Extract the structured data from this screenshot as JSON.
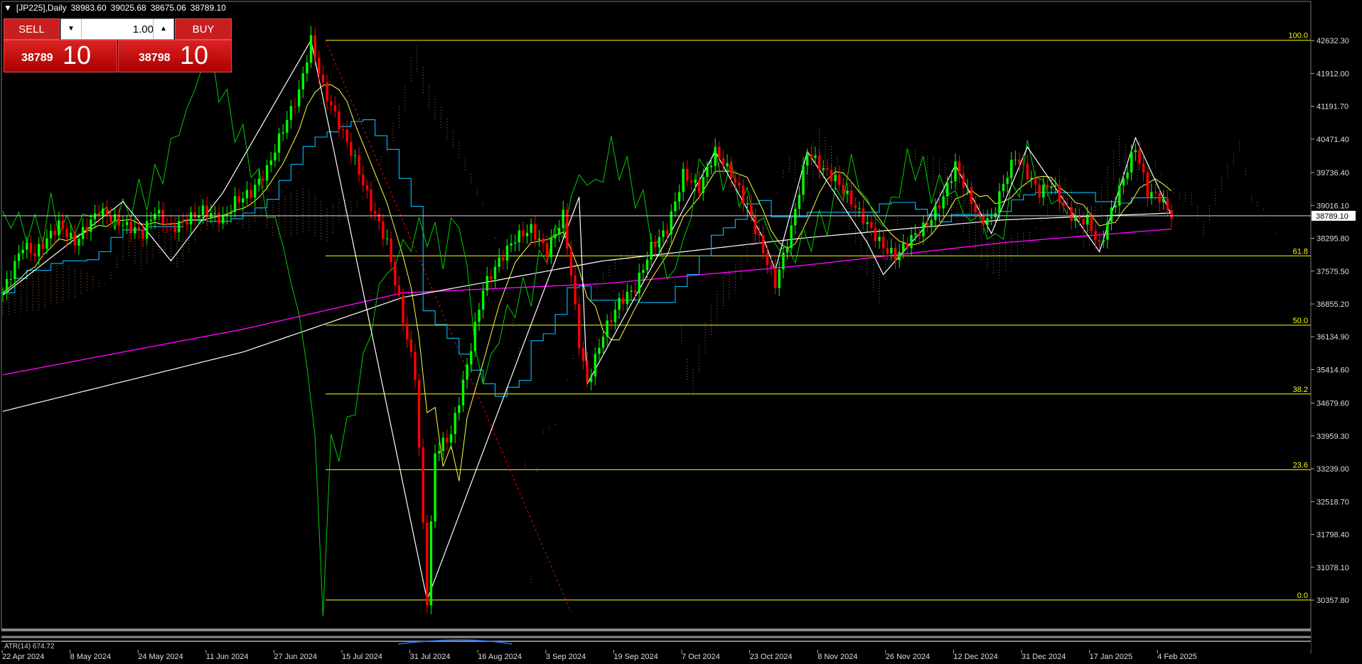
{
  "header": {
    "symbol": "[JP225],Daily",
    "open": "38983.60",
    "high": "39025.68",
    "low": "38675.06",
    "close": "38789.10"
  },
  "trade_panel": {
    "sell_label": "SELL",
    "buy_label": "BUY",
    "lot_value": "1.00",
    "sell_big": "38789",
    "sell_small": "10",
    "buy_big": "38798",
    "buy_small": "10"
  },
  "price_axis": {
    "labels": [
      "42632.30",
      "41912.00",
      "41191.70",
      "40471.40",
      "39736.40",
      "39016.10",
      "38295.80",
      "37575.50",
      "36855.20",
      "36134.90",
      "35414.60",
      "34679.60",
      "33959.30",
      "33239.00",
      "32518.70",
      "31798.40",
      "31078.10",
      "30357.80"
    ],
    "current_price": "38789.10"
  },
  "fib_levels": [
    {
      "label": "100.0",
      "price": 42640
    },
    {
      "label": "61.8",
      "price": 37910
    },
    {
      "label": "50.0",
      "price": 36390
    },
    {
      "label": "38.2",
      "price": 34880
    },
    {
      "label": "23.6",
      "price": 33220
    },
    {
      "label": "0.0",
      "price": 30360
    }
  ],
  "time_axis": {
    "labels": [
      "22 Apr 2024",
      "8 May 2024",
      "24 May 2024",
      "11 Jun 2024",
      "27 Jun 2024",
      "15 Jul 2024",
      "31 Jul 2024",
      "16 Aug 2024",
      "3 Sep 2024",
      "19 Sep 2024",
      "7 Oct 2024",
      "23 Oct 2024",
      "8 Nov 2024",
      "26 Nov 2024",
      "12 Dec 2024",
      "31 Dec 2024",
      "17 Jan 2025",
      "4 Feb 2025"
    ]
  },
  "atr_panel": {
    "label": "ATR(14) 674.72",
    "value": "674.72"
  },
  "colors": {
    "bull": "#00ff00",
    "bear": "#ff0000",
    "fib": "#ffff00",
    "ma_magenta": "#ff00ff",
    "ma_white": "#ffffff",
    "kijun": "#00bfff",
    "chikou": "#00cc00",
    "cloud": "#f4a460"
  },
  "chart_data": {
    "type": "candlestick",
    "price_min": 30000,
    "price_max": 42900,
    "series": [
      {
        "name": "price",
        "points": [
          [
            0,
            37100
          ],
          [
            5,
            38150
          ],
          [
            8,
            37950
          ],
          [
            14,
            38600
          ],
          [
            18,
            38200
          ],
          [
            24,
            38900
          ],
          [
            30,
            38600
          ],
          [
            35,
            38400
          ],
          [
            38,
            38900
          ],
          [
            42,
            38500
          ],
          [
            50,
            38900
          ],
          [
            55,
            38700
          ],
          [
            58,
            39100
          ],
          [
            62,
            39300
          ],
          [
            66,
            39800
          ],
          [
            70,
            40700
          ],
          [
            74,
            41500
          ],
          [
            77,
            42640
          ],
          [
            80,
            41600
          ],
          [
            84,
            40800
          ],
          [
            88,
            40000
          ],
          [
            92,
            39000
          ],
          [
            96,
            38200
          ],
          [
            100,
            36500
          ],
          [
            103,
            35300
          ],
          [
            106,
            30360
          ],
          [
            108,
            33600
          ],
          [
            112,
            34000
          ],
          [
            116,
            35500
          ],
          [
            120,
            37200
          ],
          [
            124,
            37800
          ],
          [
            128,
            38300
          ],
          [
            132,
            38500
          ],
          [
            136,
            38000
          ],
          [
            140,
            38800
          ],
          [
            142,
            37500
          ],
          [
            144,
            36000
          ],
          [
            146,
            35100
          ],
          [
            150,
            36200
          ],
          [
            154,
            36900
          ],
          [
            158,
            37200
          ],
          [
            162,
            38100
          ],
          [
            166,
            38500
          ],
          [
            170,
            39700
          ],
          [
            174,
            39400
          ],
          [
            178,
            40200
          ],
          [
            182,
            39700
          ],
          [
            186,
            39000
          ],
          [
            190,
            38000
          ],
          [
            193,
            37300
          ],
          [
            197,
            38500
          ],
          [
            201,
            40200
          ],
          [
            205,
            39800
          ],
          [
            208,
            39600
          ],
          [
            212,
            39100
          ],
          [
            216,
            38600
          ],
          [
            220,
            38100
          ],
          [
            223,
            37900
          ],
          [
            227,
            38300
          ],
          [
            231,
            38600
          ],
          [
            235,
            39200
          ],
          [
            238,
            39900
          ],
          [
            241,
            39300
          ],
          [
            244,
            38700
          ],
          [
            247,
            38700
          ],
          [
            250,
            39500
          ],
          [
            253,
            40100
          ],
          [
            256,
            39700
          ],
          [
            259,
            39300
          ],
          [
            262,
            39500
          ],
          [
            265,
            39000
          ],
          [
            268,
            38700
          ],
          [
            271,
            38700
          ],
          [
            274,
            38100
          ],
          [
            277,
            38900
          ],
          [
            280,
            39600
          ],
          [
            283,
            40300
          ],
          [
            286,
            39300
          ],
          [
            289,
            39200
          ],
          [
            292,
            38800
          ]
        ]
      },
      {
        "name": "ma_magenta",
        "points": [
          [
            0,
            35300
          ],
          [
            60,
            36300
          ],
          [
            100,
            37100
          ],
          [
            150,
            37300
          ],
          [
            200,
            37700
          ],
          [
            250,
            38200
          ],
          [
            292,
            38500
          ]
        ]
      },
      {
        "name": "ma_white",
        "points": [
          [
            0,
            34500
          ],
          [
            60,
            35800
          ],
          [
            100,
            37000
          ],
          [
            150,
            37800
          ],
          [
            200,
            38300
          ],
          [
            250,
            38700
          ],
          [
            292,
            38850
          ]
        ]
      }
    ]
  }
}
